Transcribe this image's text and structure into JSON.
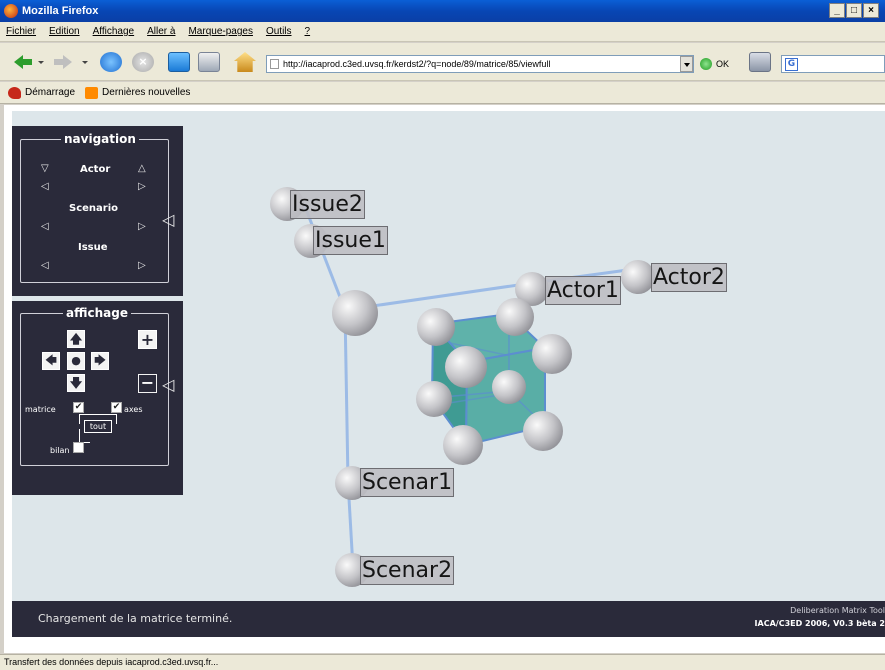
{
  "window": {
    "title": "Mozilla Firefox",
    "buttons": [
      "_",
      "□",
      "×"
    ]
  },
  "menu": {
    "items": [
      {
        "label": "Fichier"
      },
      {
        "label": "Edition"
      },
      {
        "label": "Affichage"
      },
      {
        "label": "Aller à"
      },
      {
        "label": "Marque-pages"
      },
      {
        "label": "Outils"
      },
      {
        "label": "?"
      }
    ]
  },
  "toolbar": {
    "url": "http://iacaprod.c3ed.uvsq.fr/kerdst2/?q=node/89/matrice/85/viewfull",
    "go_label": "OK",
    "search_icon_letter": "G"
  },
  "bookmarks": [
    {
      "label": "Démarrage"
    },
    {
      "label": "Dernières nouvelles"
    }
  ],
  "app": {
    "navigation": {
      "title": "navigation",
      "rows": [
        {
          "label": "Actor"
        },
        {
          "label": "Scenario"
        },
        {
          "label": "Issue"
        }
      ]
    },
    "affichage": {
      "title": "affichage",
      "matrice_label": "matrice",
      "axes_label": "axes",
      "tout_label": "tout",
      "bilan_label": "bilan",
      "matrice_checked": true,
      "axes_checked": true,
      "bilan_checked": false,
      "plus_label": "+",
      "minus_label": "−"
    },
    "nodes": [
      {
        "label": "Issue2"
      },
      {
        "label": "Issue1"
      },
      {
        "label": "Actor1"
      },
      {
        "label": "Actor2"
      },
      {
        "label": "Scenar1"
      },
      {
        "label": "Scenar2"
      }
    ],
    "status_message": "Chargement de la matrice terminé.",
    "tool_name": "Deliberation Matrix Tool",
    "tool_version": "IACA/C3ED 2006, V0.3 bèta 2"
  },
  "statusbar": {
    "text": "Transfert des données depuis iacaprod.c3ed.uvsq.fr..."
  },
  "colors": {
    "panel": "#2a2a3a",
    "stage": "#dde6ea",
    "cube": "#3f9b93",
    "axis": "#9cbbe6"
  }
}
